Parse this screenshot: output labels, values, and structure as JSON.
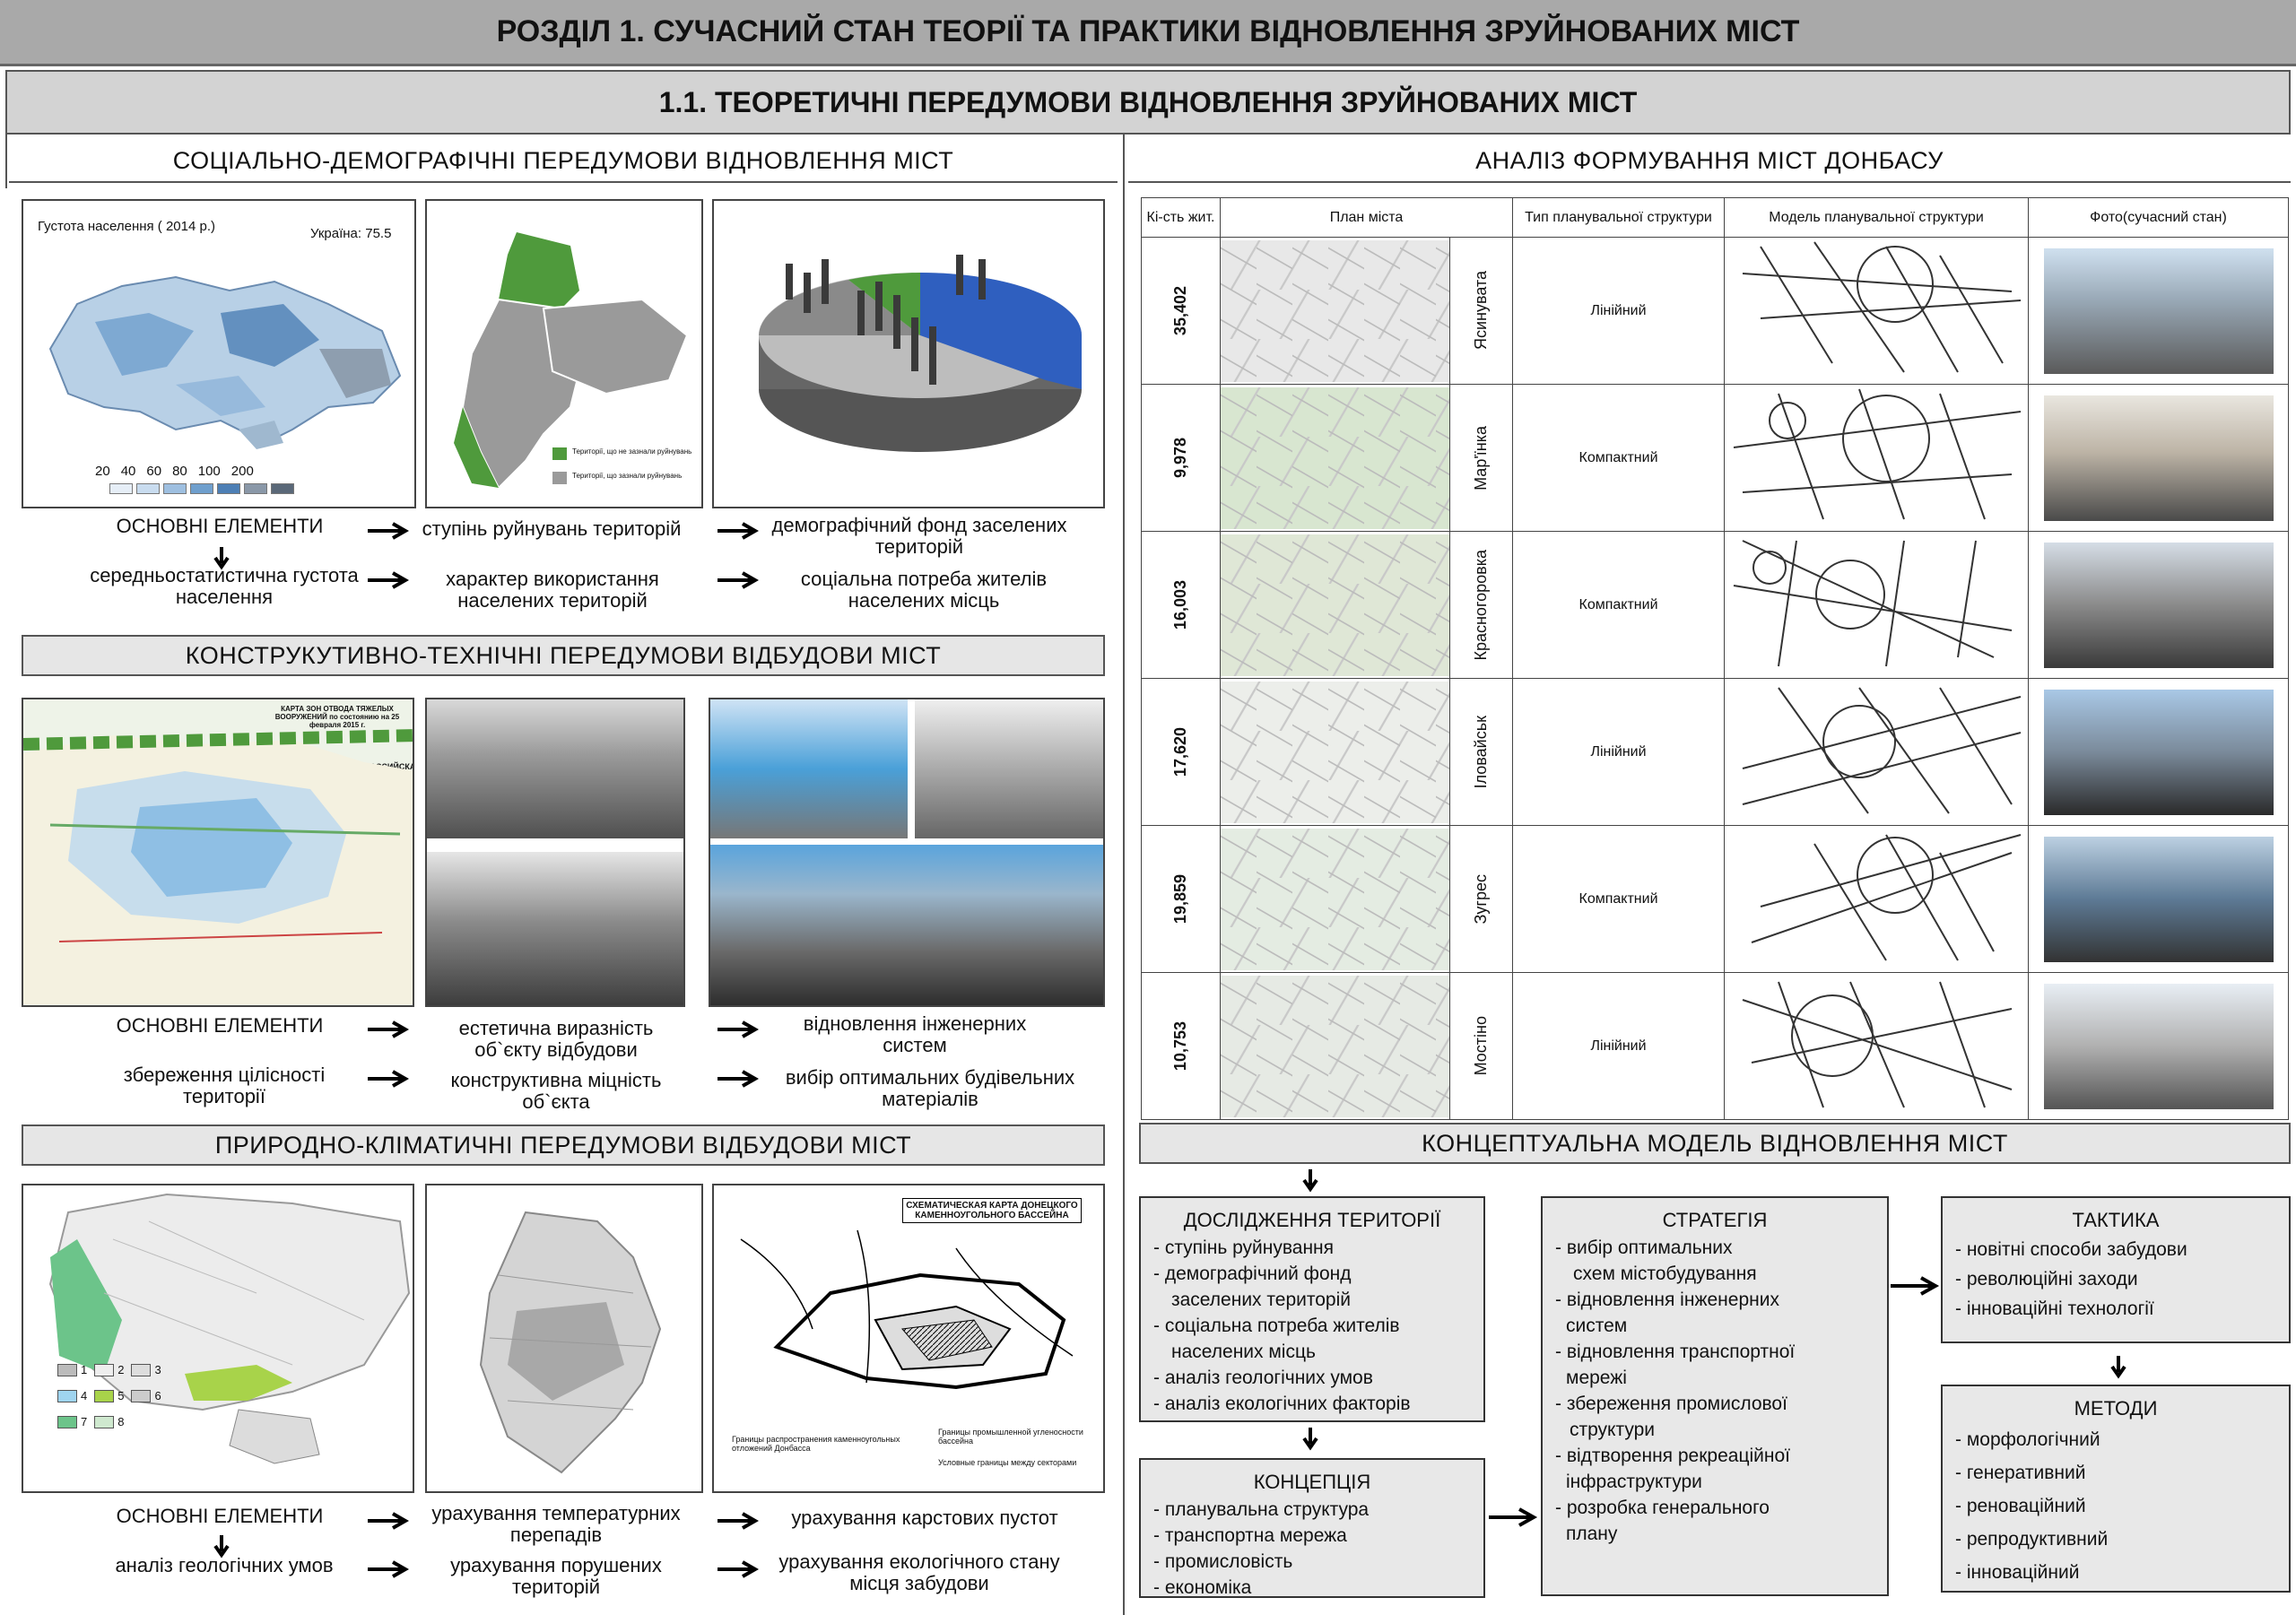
{
  "header": {
    "title": "РОЗДІЛ 1. СУЧАСНИЙ СТАН ТЕОРІЇ ТА ПРАКТИКИ ВІДНОВЛЕННЯ ЗРУЙНОВАНИХ МІСТ",
    "subtitle": "1.1. ТЕОРЕТИЧНІ ПЕРЕДУМОВИ ВІДНОВЛЕННЯ ЗРУЙНОВАНИХ МІСТ"
  },
  "social": {
    "title": "СОЦІАЛЬНО-ДЕМОГРАФІЧНІ ПЕРЕДУМОВИ ВІДНОВЛЕННЯ МІСТ",
    "map": {
      "title": "Густота населення ( 2014 р.)",
      "ukraine": "Україна: 75.5",
      "scale": [
        "20",
        "40",
        "60",
        "80",
        "100",
        "200"
      ]
    },
    "legend": {
      "not_destroyed": "Території, що не зазнали руйнувань",
      "destroyed": "Території, що зазнали руйнувань"
    },
    "row1": [
      "ОСНОВНІ ЕЛЕМЕНТИ",
      "ступінь руйнувань територій",
      "демографічний фонд заселених територій"
    ],
    "row2": [
      "середньостатистична густота населення",
      "характер використання населених територій",
      "соціальна потреба жителів населених місць"
    ]
  },
  "construct": {
    "title": "КОНСТРУКУТИВНО-ТЕХНІЧНІ ПЕРЕДУМОВИ ВІДБУДОВИ МІСТ",
    "map": {
      "title": "КАРТА ЗОН ОТВОДА ТЯЖЕЛЫХ ВООРУЖЕНИЙ по состоянию на 25 февраля 2015 г.",
      "russia": "РОССИЙСКАЯ ФЕДЕРАЦИЯ"
    },
    "row1": [
      "ОСНОВНІ ЕЛЕМЕНТИ",
      "естетична виразність об`єкту відбудови",
      "відновлення інженерних систем"
    ],
    "row2": [
      "збереження цілісності території",
      "конструктивна міцність об`єкта",
      "вибір оптимальних будівельних матеріалів"
    ]
  },
  "nature": {
    "title": "ПРИРОДНО-КЛІМАТИЧНІ ПЕРЕДУМОВИ ВІДБУДОВИ МІСТ",
    "legend_nums": [
      "1",
      "2",
      "3",
      "4",
      "5",
      "6",
      "7",
      "8"
    ],
    "coal_map": {
      "title": "СХЕМАТИЧЕСКАЯ КАРТА ДОНЕЦКОГО КАМЕННОУГОЛЬНОГО БАССЕЙНА",
      "legend1": "Границы распространения каменноугольных отложений Донбасса",
      "legend2": "Границы промышленной угленосности бассейна",
      "legend3": "Условные границы между секторами"
    },
    "row1": [
      "ОСНОВНІ ЕЛЕМЕНТИ",
      "урахування температурних перепадів",
      "урахування карстових пустот"
    ],
    "row2": [
      "аналіз геологічних умов",
      "урахування порушених територій",
      "урахування екологічного стану місця забудови"
    ]
  },
  "analysis": {
    "title": "АНАЛІЗ ФОРМУВАННЯ МІСТ ДОНБАСУ",
    "headers": [
      "Кі-сть жит.",
      "План міста",
      "Тип планувальної структури",
      "Модель планувальної структури",
      "Фото(сучасний стан)"
    ],
    "rows": [
      {
        "pop": "35,402",
        "city": "Ясинувата",
        "type": "Лінійний"
      },
      {
        "pop": "9,978",
        "city": "Мар'їнка",
        "type": "Компактний"
      },
      {
        "pop": "16,003",
        "city": "Красногоровка",
        "type": "Компактний"
      },
      {
        "pop": "17,620",
        "city": "Іловайськ",
        "type": "Лінійний"
      },
      {
        "pop": "19,859",
        "city": "Зугрес",
        "type": "Компактний"
      },
      {
        "pop": "10,753",
        "city": "Мостіно",
        "type": "Лінійний"
      }
    ]
  },
  "concept": {
    "title": "КОНЦЕПТУАЛЬНА МОДЕЛЬ ВІДНОВЛЕННЯ МІСТ",
    "research": {
      "title": "ДОСЛІДЖЕННЯ ТЕРИТОРІЇ",
      "items": [
        "- ступінь руйнування",
        "- демографічний фонд",
        "заселених територій",
        "- соціальна потреба жителів",
        "населених місць",
        "- аналіз геологічних умов",
        "- аналіз екологічних факторів"
      ]
    },
    "concept_box": {
      "title": "КОНЦЕПЦІЯ",
      "items": [
        "- планувальна структура",
        "- транспортна мережа",
        "-  промисловість",
        "-  економіка"
      ]
    },
    "strategy": {
      "title": "СТРАТЕГІЯ",
      "items": [
        "- вибір оптимальних",
        "схем містобудування",
        "- відновлення інженерних",
        "систем",
        "- відновлення транспортної",
        "мережі",
        "- збереження промислової",
        "структури",
        "- відтворення рекреаційної",
        "інфраструктури",
        "- розробка генерального",
        "плану"
      ]
    },
    "tactics": {
      "title": "ТАКТИКА",
      "items": [
        "- новітні способи забудови",
        "- революційні заходи",
        "- інноваційні технології"
      ]
    },
    "methods": {
      "title": "МЕТОДИ",
      "items": [
        "- морфологічний",
        "- генеративний",
        "- реноваційний",
        "- репродуктивний",
        "- інноваційний"
      ]
    }
  },
  "colors": {
    "title_bar": "#a9a9a9",
    "subtitle_bar": "#d3d3d3",
    "section": "#e6e6e6",
    "green": "#4f9a3c",
    "blue": "#2f5fbf"
  }
}
